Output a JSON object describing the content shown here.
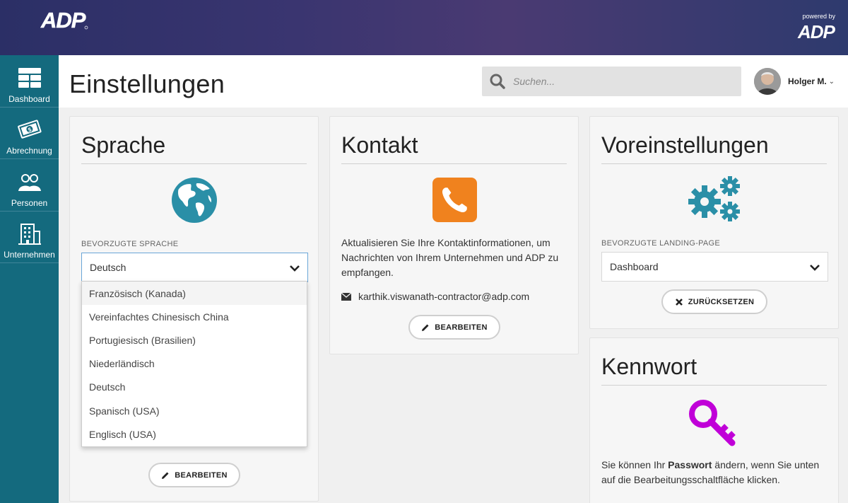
{
  "banner": {
    "brand_logo": "ADP",
    "powered_by": "powered by",
    "powered_logo": "ADP"
  },
  "sidebar": {
    "items": [
      {
        "label": "Dashboard",
        "icon": "dashboard-icon"
      },
      {
        "label": "Abrechnung",
        "icon": "money-icon"
      },
      {
        "label": "Personen",
        "icon": "people-icon"
      },
      {
        "label": "Unternehmen",
        "icon": "building-icon"
      }
    ]
  },
  "header": {
    "title": "Einstellungen",
    "search_placeholder": "Suchen...",
    "user_name": "Holger M.",
    "user_chevron": "⌄"
  },
  "sprache": {
    "title": "Sprache",
    "label": "BEVORZUGTE SPRACHE",
    "selected": "Deutsch",
    "edit_label": "BEARBEITEN",
    "options": [
      "Französisch (Kanada)",
      "Vereinfachtes Chinesisch China",
      "Portugiesisch (Brasilien)",
      "Niederländisch",
      "Deutsch",
      "Spanisch (USA)",
      "Englisch (USA)"
    ]
  },
  "kontakt": {
    "title": "Kontakt",
    "description": "Aktualisieren Sie Ihre Kontaktinformationen, um Nachrichten von Ihrem Unternehmen und ADP zu empfangen.",
    "email": "karthik.viswanath-contractor@adp.com",
    "edit_label": "BEARBEITEN"
  },
  "voreinstellungen": {
    "title": "Voreinstellungen",
    "label": "BEVORZUGTE LANDING-PAGE",
    "selected": "Dashboard",
    "reset_label": "ZURÜCKSETZEN"
  },
  "kennwort": {
    "title": "Kennwort",
    "text_before": "Sie können Ihr ",
    "text_bold": "Passwort",
    "text_after": " ändern, wenn Sie unten auf die Bearbeitungsschaltfläche klicken."
  },
  "colors": {
    "sidebar": "#146a7e",
    "globe": "#2a8fa7",
    "phone": "#f0821e",
    "gears": "#2a8fa7",
    "key": "#c000d8"
  }
}
